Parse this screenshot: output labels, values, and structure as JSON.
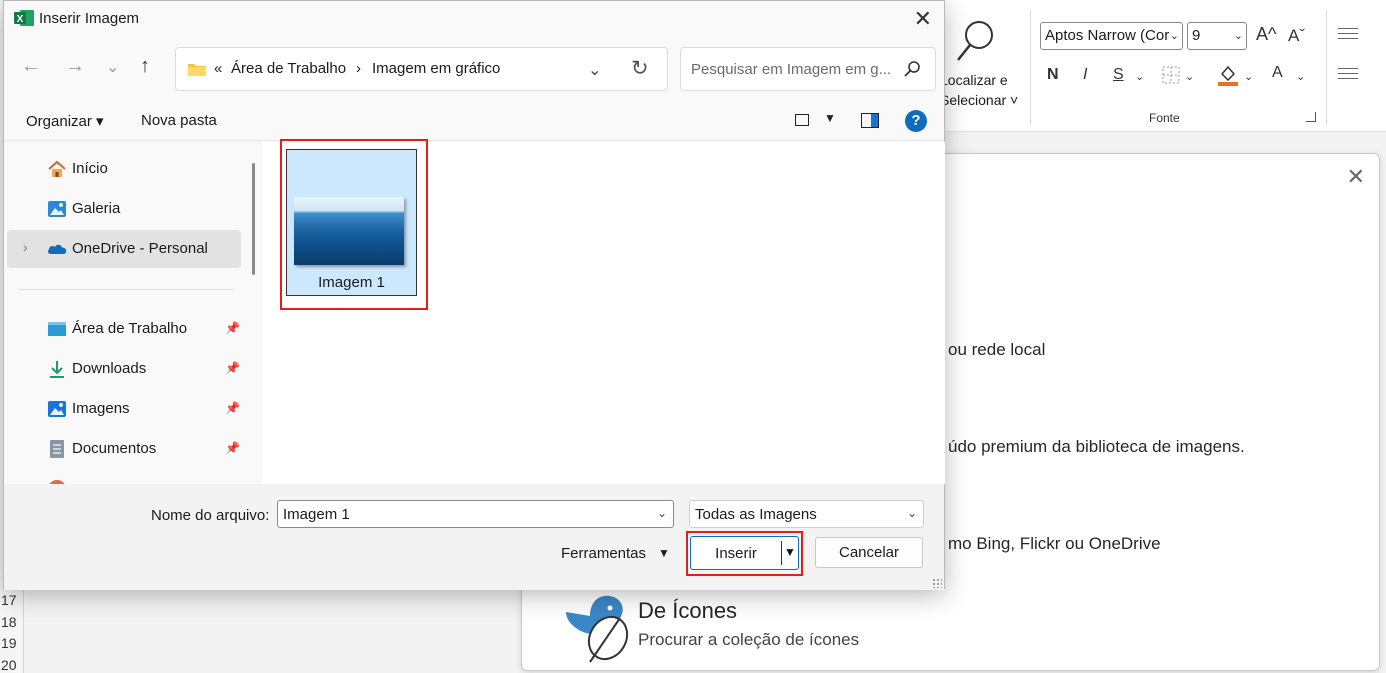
{
  "dialog": {
    "title": "Inserir Imagem",
    "breadcrumb": [
      "«",
      "Área de Trabalho",
      "›",
      "Imagem em gráfico"
    ],
    "search_placeholder": "Pesquisar em Imagem em g...",
    "organize_label": "Organizar ▾",
    "new_folder_label": "Nova pasta",
    "help_label": "?",
    "nav_items": [
      {
        "label": "Início",
        "icon": "home-icon"
      },
      {
        "label": "Galeria",
        "icon": "gallery-icon"
      },
      {
        "label": "OneDrive - Personal",
        "icon": "onedrive-cloud-icon",
        "selected": true
      },
      {
        "label": "Área de Trabalho",
        "icon": "desktop-icon",
        "pinned": true
      },
      {
        "label": "Downloads",
        "icon": "download-icon",
        "pinned": true
      },
      {
        "label": "Imagens",
        "icon": "pictures-icon",
        "pinned": true
      },
      {
        "label": "Documentos",
        "icon": "documents-icon",
        "pinned": true
      }
    ],
    "files": [
      {
        "name": "Imagem 1",
        "selected": true
      }
    ],
    "filename_label": "Nome do arquivo:",
    "filename_value": "Imagem 1",
    "filter_value": "Todas as Imagens",
    "tools_label": "Ferramentas",
    "insert_label": "Inserir",
    "cancel_label": "Cancelar"
  },
  "ribbon": {
    "find_label_1": "Localizar e",
    "find_label_2": "Selecionar ˅",
    "font_name": "Aptos Narrow (Cor",
    "font_size": "9",
    "grow_font": "A^",
    "shrink_font": "Aˇ",
    "bold": "N",
    "italic": "I",
    "underline": "S",
    "font_color": "A",
    "group_label": "Fonte"
  },
  "pane": {
    "line1": "ou rede local",
    "line2": "údo premium da biblioteca de imagens.",
    "line3": "mo Bing, Flickr ou OneDrive",
    "icons_title": "De Ícones",
    "icons_sub": "Procurar a coleção de ícones"
  },
  "sheet": {
    "rows": [
      "17",
      "18",
      "19",
      "20"
    ]
  },
  "colors": {
    "accent": "#0f6cbd",
    "selection": "#cce8ff",
    "highlight_red": "#e0201c"
  }
}
